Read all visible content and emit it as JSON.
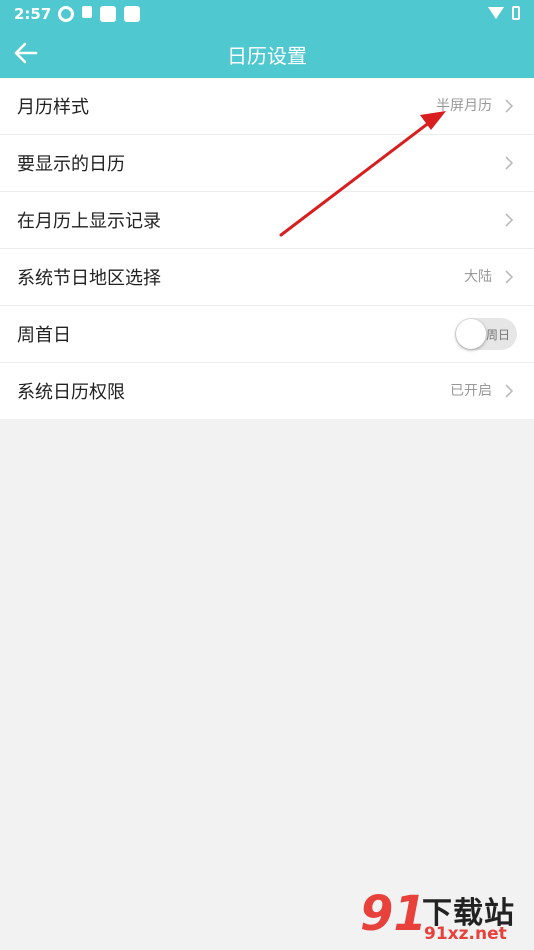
{
  "status": {
    "time": "2:57"
  },
  "header": {
    "title": "日历设置"
  },
  "settings": {
    "items": [
      {
        "label": "月历样式",
        "value": "半屏月历"
      },
      {
        "label": "要显示的日历",
        "value": ""
      },
      {
        "label": "在月历上显示记录",
        "value": ""
      },
      {
        "label": "系统节日地区选择",
        "value": "大陆"
      },
      {
        "label": "周首日",
        "toggle_text": "周日",
        "toggle_on": false
      },
      {
        "label": "系统日历权限",
        "value": "已开启"
      }
    ]
  },
  "colors": {
    "accent": "#4fc9cf",
    "annotation_arrow": "#d81e1e"
  },
  "watermark": {
    "logo": "91",
    "title": "下载站",
    "url": "91xz.net"
  }
}
